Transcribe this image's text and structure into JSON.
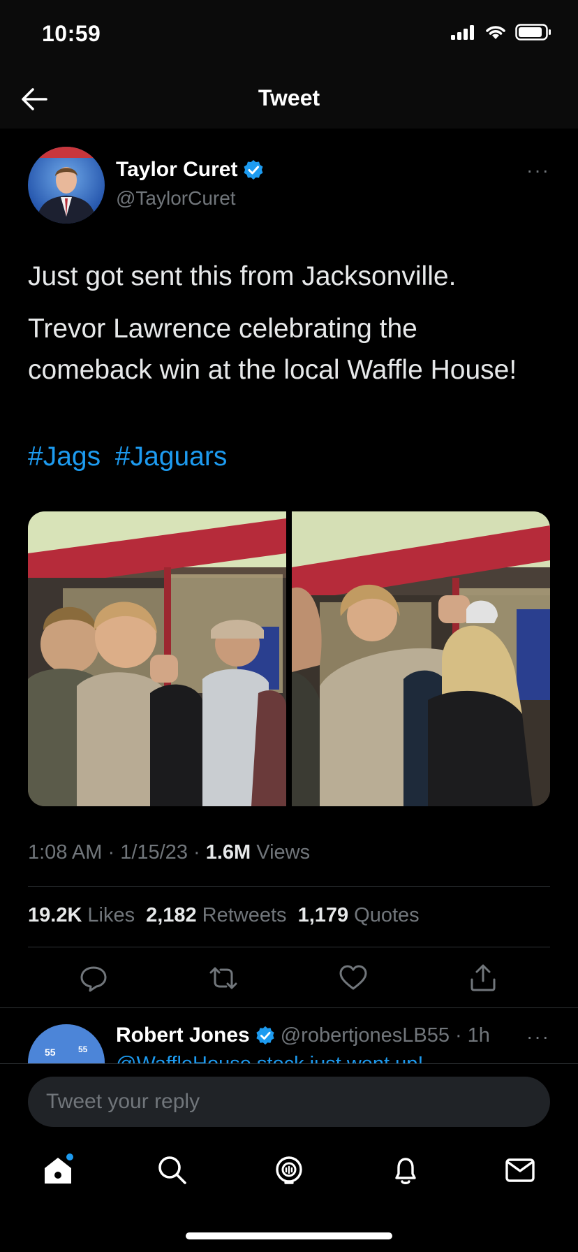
{
  "status_bar": {
    "time": "10:59"
  },
  "header": {
    "title": "Tweet"
  },
  "tweet": {
    "author_name": "Taylor Curet",
    "author_handle": "@TaylorCuret",
    "text_line1": "Just got sent this from Jacksonville.",
    "text_line2": "Trevor Lawrence celebrating the comeback win at the local Waffle House!",
    "hashtags": [
      "#Jags",
      "#Jaguars"
    ],
    "time": "1:08 AM",
    "date": "1/15/23",
    "views_count": "1.6M",
    "views_label": "Views",
    "likes_count": "19.2K",
    "likes_label": "Likes",
    "retweets_count": "2,182",
    "retweets_label": "Retweets",
    "quotes_count": "1,179",
    "quotes_label": "Quotes",
    "more_label": "···"
  },
  "reply": {
    "author_name": "Robert Jones",
    "author_handle": "@robertjonesLB55",
    "age": "1h",
    "text_preview": "@WaffleHouse stock just went up!",
    "more_label": "···"
  },
  "compose": {
    "placeholder": "Tweet your reply"
  },
  "colors": {
    "accent": "#1d9bf0",
    "background": "#000000",
    "muted": "#71767b"
  }
}
